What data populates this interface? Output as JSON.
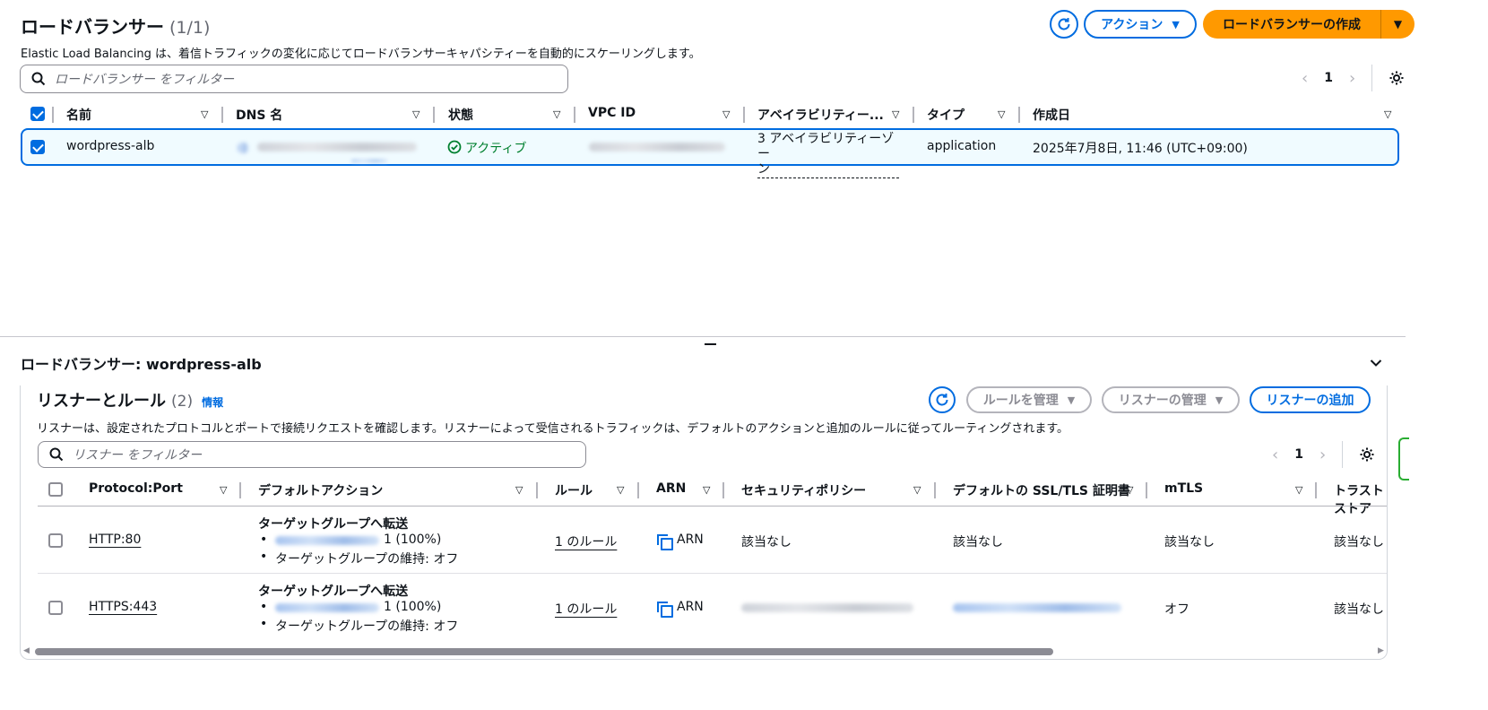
{
  "lb_list": {
    "title": "ロードバランサー",
    "count": "(1/1)",
    "description": "Elastic Load Balancing は、着信トラフィックの変化に応じてロードバランサーキャパシティーを自動的にスケーリングします。",
    "actions_label": "アクション",
    "create_label": "ロードバランサーの作成",
    "search_placeholder": "ロードバランサー をフィルター",
    "page": "1",
    "columns": [
      "名前",
      "DNS 名",
      "状態",
      "VPC ID",
      "アベイラビリティー...",
      "タイプ",
      "作成日"
    ],
    "row": {
      "name": "wordpress-alb",
      "state": "アクティブ",
      "az_line1": "3 アベイラビリティーゾー",
      "az_line2": "ン",
      "type": "application",
      "created": "2025年7月8日, 11:46 (UTC+09:00)"
    }
  },
  "details": {
    "title": "ロードバランサー: wordpress-alb"
  },
  "listeners": {
    "title": "リスナーとルール",
    "count": "(2)",
    "info": "情報",
    "manage_rules_label": "ルールを管理",
    "manage_listeners_label": "リスナーの管理",
    "add_listener_label": "リスナーの追加",
    "description": "リスナーは、設定されたプロトコルとポートで接続リクエストを確認します。リスナーによって受信されるトラフィックは、デフォルトのアクションと追加のルールに従ってルーティングされます。",
    "search_placeholder": "リスナー をフィルター",
    "page": "1",
    "columns": [
      "Protocol:Port",
      "デフォルトアクション",
      "ルール",
      "ARN",
      "セキュリティポリシー",
      "デフォルトの SSL/TLS 証明書",
      "mTLS",
      "トラストストア"
    ],
    "rows": [
      {
        "protocol": "HTTP:80",
        "action_title": "ターゲットグループへ転送",
        "action_weight": "1 (100%)",
        "action_stickiness": "ターゲットグループの維持: オフ",
        "rules": "1 のルール",
        "arn": "ARN",
        "security_policy": "該当なし",
        "certificate": "該当なし",
        "mtls": "該当なし",
        "truststore": "該当なし"
      },
      {
        "protocol": "HTTPS:443",
        "action_title": "ターゲットグループへ転送",
        "action_weight": "1 (100%)",
        "action_stickiness": "ターゲットグループの維持: オフ",
        "rules": "1 のルール",
        "arn": "ARN",
        "security_policy": "",
        "certificate": "",
        "mtls": "オフ",
        "truststore": "該当なし"
      }
    ]
  },
  "colors": {
    "accent": "#006ce0",
    "primary": "#ff9900",
    "success": "#00802f"
  }
}
